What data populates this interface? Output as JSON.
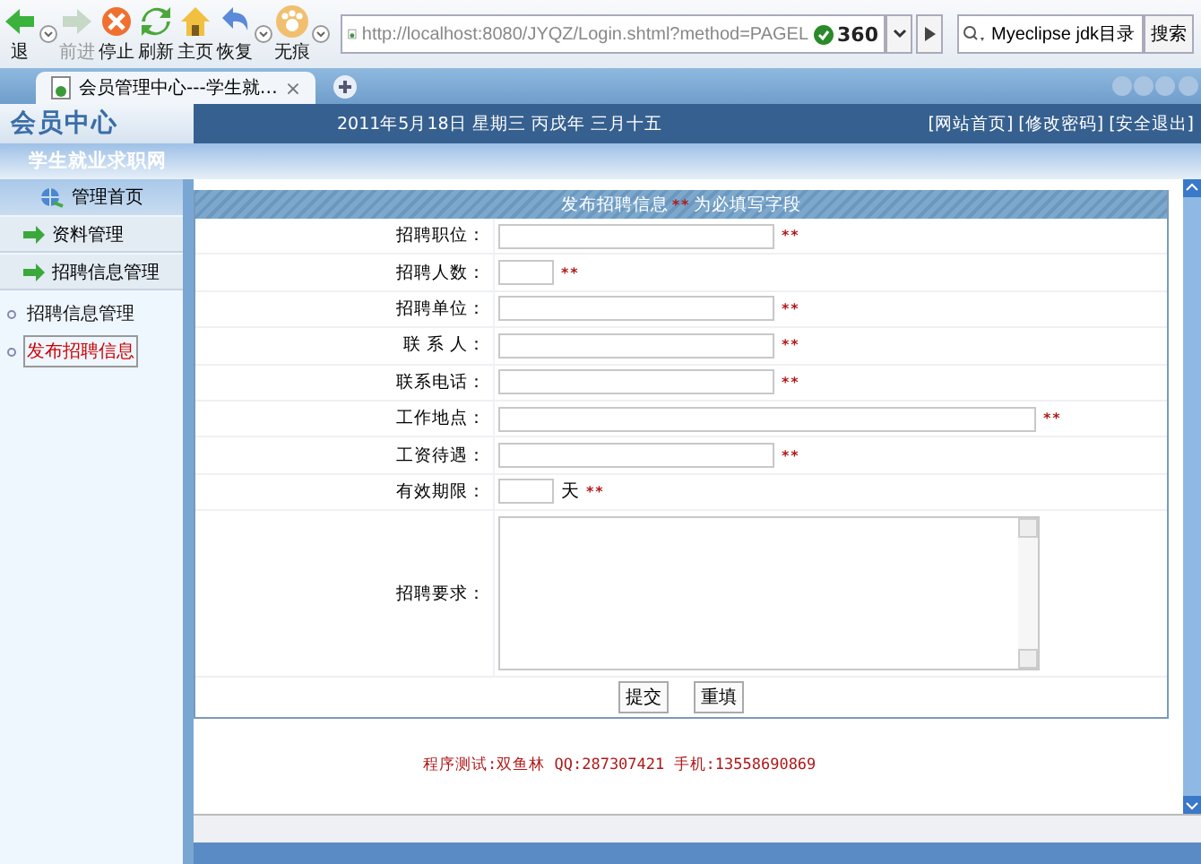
{
  "toolbar": {
    "buttons": [
      {
        "label": "退",
        "kind": "back",
        "disabled": false
      },
      {
        "label": "前进",
        "kind": "forward",
        "disabled": true
      },
      {
        "label": "停止",
        "kind": "stop",
        "disabled": false
      },
      {
        "label": "刷新",
        "kind": "refresh",
        "disabled": false
      },
      {
        "label": "主页",
        "kind": "home",
        "disabled": false
      },
      {
        "label": "恢复",
        "kind": "undo",
        "disabled": false
      },
      {
        "label": "无痕",
        "kind": "paw",
        "disabled": false
      }
    ],
    "address": {
      "url": "http://localhost:8080/JYQZ/Login.shtml?method=PAGEL",
      "badge": "360"
    },
    "search": {
      "value": "Myeclipse jdk目录",
      "button": "搜索"
    }
  },
  "tabs": [
    {
      "label": "会员管理中心---学生就…",
      "close": "×",
      "selected": true
    }
  ],
  "header": {
    "logo": "会员中心",
    "date": "2011年5月18日 星期三 丙戌年 三月十五",
    "links": [
      "[网站首页]",
      "[修改密码]",
      "[安全退出]"
    ],
    "subtitle": "学生就业求职网"
  },
  "sidebar": {
    "home": "管理首页",
    "sections": [
      {
        "label": "资料管理"
      },
      {
        "label": "招聘信息管理"
      }
    ],
    "links": [
      {
        "label": "招聘信息管理",
        "selected": false
      },
      {
        "label": "发布招聘信息",
        "selected": true
      }
    ]
  },
  "form": {
    "title": "发布招聘信息",
    "required_mark": "**",
    "required_note": "为必填写字段",
    "fields": [
      {
        "label": "招聘职位：",
        "kind": "text",
        "required": true
      },
      {
        "label": "招聘人数：",
        "kind": "short",
        "required": true
      },
      {
        "label": "招聘单位：",
        "kind": "text",
        "required": true
      },
      {
        "label": "联 系 人：",
        "kind": "text",
        "required": true
      },
      {
        "label": "联系电话：",
        "kind": "text",
        "required": true
      },
      {
        "label": "工作地点：",
        "kind": "long",
        "required": true
      },
      {
        "label": "工资待遇：",
        "kind": "text",
        "required": true
      },
      {
        "label": "有效期限：",
        "kind": "short",
        "suffix": "天",
        "required": true
      },
      {
        "label": "招聘要求：",
        "kind": "textarea",
        "required": false
      }
    ],
    "buttons": [
      "提交",
      "重填"
    ]
  },
  "footer": "程序测试:双鱼林 QQ:287307421 手机:13558690869"
}
